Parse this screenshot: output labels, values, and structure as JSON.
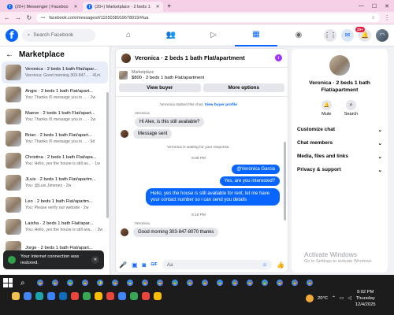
{
  "browser": {
    "tabs": [
      {
        "label": "(20+) Messenger | Faceboo",
        "active": false
      },
      {
        "label": "(20+) Marketplace - 2 beds 1",
        "active": true
      }
    ],
    "url": "facebook.com/messages/t/1155038919678019/#tua"
  },
  "fb": {
    "search_placeholder": "Search Facebook",
    "notif_badge": "20+"
  },
  "left": {
    "title": "Marketplace",
    "items": [
      {
        "name": "Veronica · 2 beds 1 bath Flat/apar...",
        "snippet": "Veronica: Good morning 303-847... · 41m",
        "selected": true
      },
      {
        "name": "Angie · 2 beds 1 bath Flat/apart...",
        "snippet": "You: Thanks i'll message you in ... · 2w"
      },
      {
        "name": "Maeve · 2 beds 1 bath Flat/apart...",
        "snippet": "You: Thanks i'll message you in ... · 2w"
      },
      {
        "name": "Brian · 2 beds 1 bath Flat/apart...",
        "snippet": "You: Thanks i'll message you in ... · 6d"
      },
      {
        "name": "Christina · 2 beds 1 bath Flat/apa...",
        "snippet": "You: Hello, yes the house is still av... · 1w"
      },
      {
        "name": "JLuis · 2 beds 1 bath Flat/apartm...",
        "snippet": "You: @Luis Jimenez · 2w"
      },
      {
        "name": "Leo · 2 beds 1 bath Flat/apartm...",
        "snippet": "You: Please verify our website · 2w"
      },
      {
        "name": "Laisha · 2 beds 1 bath Flat/apar...",
        "snippet": "You: Hello, yes the house is still ava... · 3w"
      },
      {
        "name": "Jorge · 2 beds 1 bath Flat/apart...",
        "snippet": ""
      }
    ],
    "toast": "Your internet connection was restored."
  },
  "chat": {
    "title": "Veronica · 2 beds 1 bath Flat/apartment",
    "listing_source": "Marketplace",
    "listing": "$800 · 2 beds 1 bath Flat/apartment",
    "view_buyer": "View buyer",
    "more_options": "More options",
    "started": "Veronica started this chat.",
    "view_profile": "View buyer profile",
    "sender": "Veronica",
    "msg_in_1": "Hi Alex, is this still available?",
    "msg_in_2": "Message sent",
    "waiting": "Veronica is waiting for your response.",
    "time_1": "5:08 PM",
    "msg_out_1": "@Veronica Garcia",
    "msg_out_2": "Yes, are you interested?",
    "msg_out_3": "Hello, yes the house is still available for rent, let me have your contact number so i can send you details",
    "time_2": "8:19 PM",
    "sender_2": "Veronica",
    "msg_in_3": "Good morning 303-847-8070 thanks",
    "input_placeholder": "Aa"
  },
  "right": {
    "title": "Veronica · 2 beds 1 bath Flat/apartment",
    "mute": "Mute",
    "search": "Search",
    "sections": [
      "Customize chat",
      "Chat members",
      "Media, files and links",
      "Privacy & support"
    ]
  },
  "watermark": {
    "line1": "Activate Windows",
    "line2": "Go to Settings to activate Windows."
  },
  "taskbar": {
    "temp": "20°C",
    "time": "9:02 PM",
    "day": "Thursday",
    "date": "12/4/2025"
  },
  "colors": {
    "accent": "#0866ff",
    "chrome": "#f5d0e6"
  }
}
